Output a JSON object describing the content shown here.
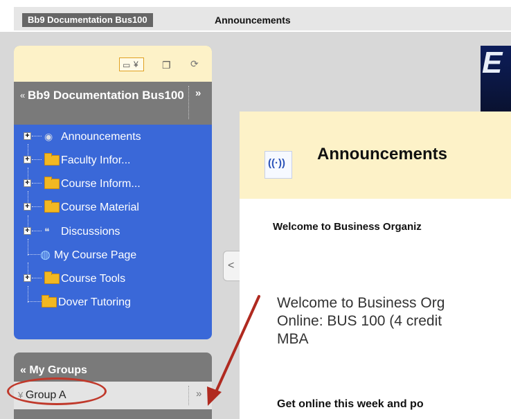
{
  "breadcrumb": {
    "course": "Bb9 Documentation Bus100",
    "page": "Announcements"
  },
  "menu_toolbar": {
    "icons": [
      "folder-view-icon",
      "chevron-down-icon",
      "new-window-icon",
      "refresh-icon"
    ]
  },
  "course_menu": {
    "title": "Bb9 Documentation Bus100",
    "items": [
      {
        "label": "Announcements",
        "icon": "announcement-icon",
        "expandable": true
      },
      {
        "label": "Faculty Infor...",
        "icon": "folder-icon",
        "expandable": true
      },
      {
        "label": "Course Inform...",
        "icon": "folder-icon",
        "expandable": true
      },
      {
        "label": "Course Material",
        "icon": "folder-icon",
        "expandable": true
      },
      {
        "label": "Discussions",
        "icon": "discussion-icon",
        "expandable": true
      },
      {
        "label": "My Course Page",
        "icon": "globe-icon",
        "expandable": false
      },
      {
        "label": "Course Tools",
        "icon": "folder-icon",
        "expandable": true
      },
      {
        "label": "Dover Tutoring",
        "icon": "folder-icon",
        "expandable": false
      }
    ]
  },
  "my_groups": {
    "title": "My Groups",
    "group": "Group A"
  },
  "content": {
    "title": "Announcements",
    "intro": "Welcome to Business Organiz",
    "body_line1": "Welcome to Business Org",
    "body_line2": "Online: BUS 100 (4 credit",
    "body_line3": "MBA",
    "cta": "Get online this week and po"
  },
  "banner": {
    "text": "E"
  },
  "colors": {
    "menu_blue": "#3a68d8",
    "toolbar_yellow": "#fdf2c8",
    "header_gray": "#7a7a7a",
    "annotation_red": "#c0392b"
  }
}
